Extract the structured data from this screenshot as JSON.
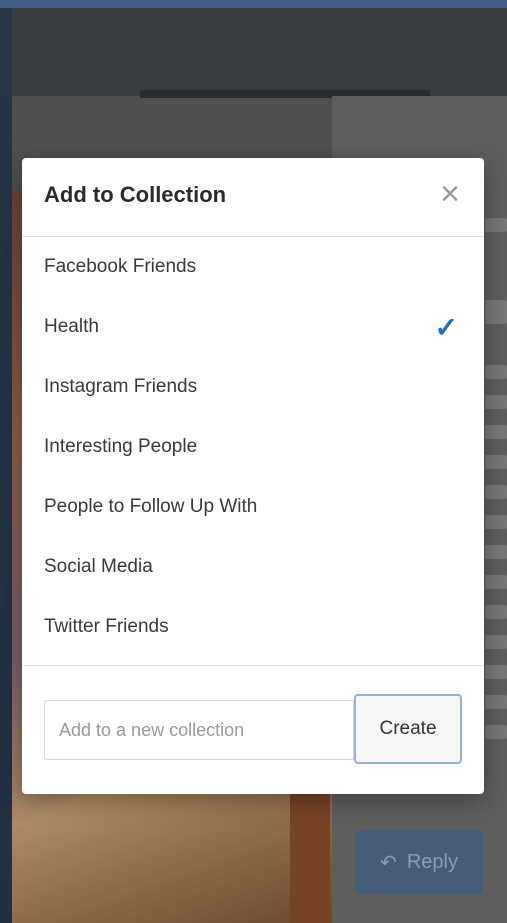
{
  "modal": {
    "title": "Add to Collection",
    "close_icon": "close-icon",
    "collections": [
      {
        "label": "Facebook Friends",
        "checked": false
      },
      {
        "label": "Health",
        "checked": true
      },
      {
        "label": "Instagram Friends",
        "checked": false
      },
      {
        "label": "Interesting People",
        "checked": false
      },
      {
        "label": "People to Follow Up With",
        "checked": false
      },
      {
        "label": "Social Media",
        "checked": false
      },
      {
        "label": "Twitter Friends",
        "checked": false
      }
    ],
    "check_glyph": "✓",
    "new_collection": {
      "placeholder": "Add to a new collection",
      "value": ""
    },
    "create_label": "Create",
    "accent_color": "#2a6fc4"
  },
  "background": {
    "reply_label": "Reply",
    "reply_icon": "reply-arrow-icon"
  }
}
